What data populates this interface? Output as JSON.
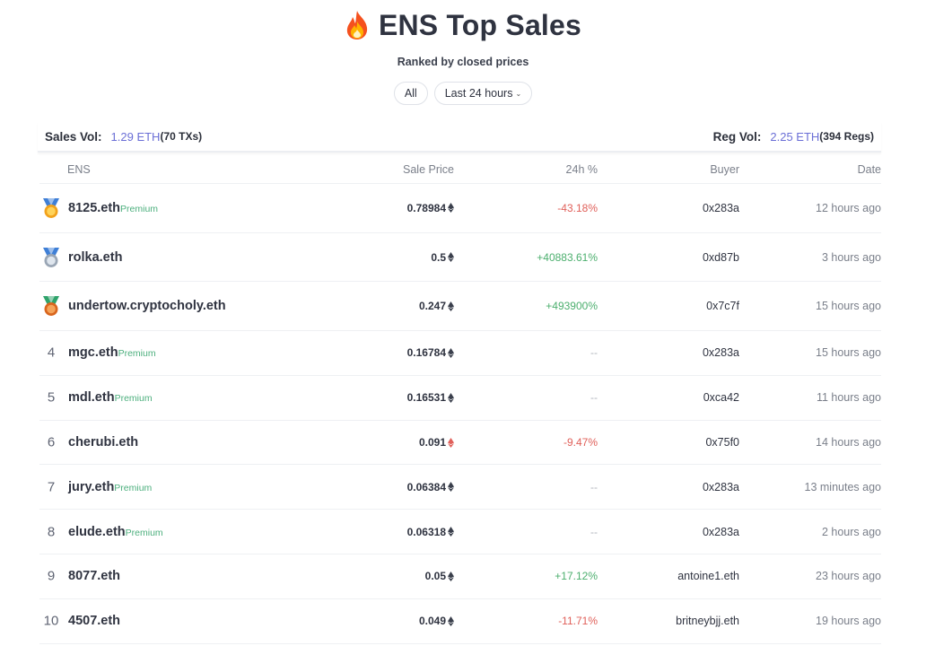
{
  "header": {
    "title": "ENS Top Sales",
    "subtitle": "Ranked by closed prices",
    "title_icon": "fire-icon"
  },
  "filters": {
    "all_label": "All",
    "period_label": "Last 24 hours"
  },
  "stats": {
    "sales_label": "Sales Vol:",
    "sales_value": "1.29 ETH",
    "sales_count": "(70 TXs)",
    "reg_label": "Reg Vol:",
    "reg_value": "2.25 ETH",
    "reg_count": "(394 Regs)"
  },
  "table": {
    "headers": {
      "ens": "ENS",
      "price": "Sale Price",
      "change": "24h %",
      "buyer": "Buyer",
      "date": "Date"
    },
    "rows": [
      {
        "rank": "1",
        "medal": "gold",
        "name": "8125.eth",
        "premium": "Premium",
        "price": "0.78984",
        "change": "-43.18%",
        "trend": "neg",
        "buyer": "0x283a",
        "date": "12 hours ago"
      },
      {
        "rank": "2",
        "medal": "silver",
        "name": "rolka.eth",
        "premium": "",
        "price": "0.5",
        "change": "+40883.61%",
        "trend": "pos",
        "buyer": "0xd87b",
        "date": "3 hours ago"
      },
      {
        "rank": "3",
        "medal": "bronze",
        "name": "undertow.cryptocholy.eth",
        "premium": "",
        "price": "0.247",
        "change": "+493900%",
        "trend": "pos",
        "buyer": "0x7c7f",
        "date": "15 hours ago"
      },
      {
        "rank": "4",
        "medal": "",
        "name": "mgc.eth",
        "premium": "Premium",
        "price": "0.16784",
        "change": "--",
        "trend": "neutral",
        "buyer": "0x283a",
        "date": "15 hours ago"
      },
      {
        "rank": "5",
        "medal": "",
        "name": "mdl.eth",
        "premium": "Premium",
        "price": "0.16531",
        "change": "--",
        "trend": "neutral",
        "buyer": "0xca42",
        "date": "11 hours ago"
      },
      {
        "rank": "6",
        "medal": "",
        "name": "cherubi.eth",
        "premium": "",
        "price": "0.091",
        "change": "-9.47%",
        "trend": "neg",
        "buyer": "0x75f0",
        "date": "14 hours ago",
        "eth_color": "red"
      },
      {
        "rank": "7",
        "medal": "",
        "name": "jury.eth",
        "premium": "Premium",
        "price": "0.06384",
        "change": "--",
        "trend": "neutral",
        "buyer": "0x283a",
        "date": "13 minutes ago"
      },
      {
        "rank": "8",
        "medal": "",
        "name": "elude.eth",
        "premium": "Premium",
        "price": "0.06318",
        "change": "--",
        "trend": "neutral",
        "buyer": "0x283a",
        "date": "2 hours ago"
      },
      {
        "rank": "9",
        "medal": "",
        "name": "8077.eth",
        "premium": "",
        "price": "0.05",
        "change": "+17.12%",
        "trend": "pos",
        "buyer": "antoine1.eth",
        "date": "23 hours ago"
      },
      {
        "rank": "10",
        "medal": "",
        "name": "4507.eth",
        "premium": "",
        "price": "0.049",
        "change": "-11.71%",
        "trend": "neg",
        "buyer": "britneybjj.eth",
        "date": "19 hours ago"
      }
    ]
  },
  "colors": {
    "accent": "#6b6fd6",
    "positive": "#4caf6e",
    "negative": "#e0605a",
    "premium": "#4caf7d"
  }
}
